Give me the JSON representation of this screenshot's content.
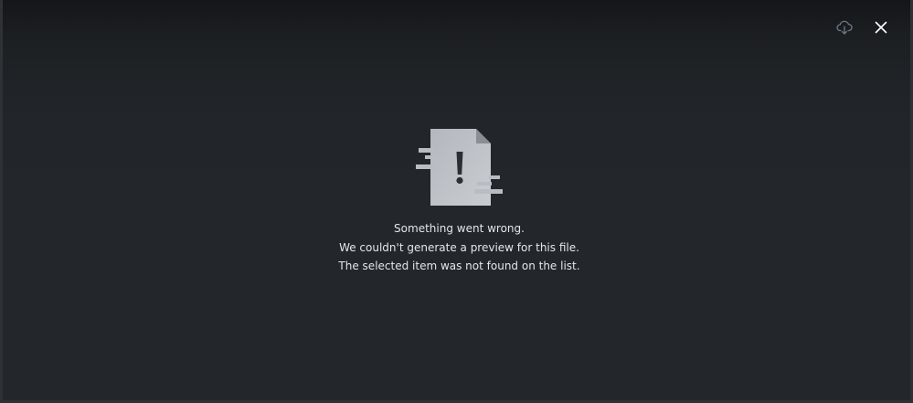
{
  "toolbar": {
    "download_icon": "cloud-download-icon",
    "close_icon": "close-icon"
  },
  "error": {
    "illustration_icon": "file-error-icon",
    "title": "Something went wrong.",
    "line1": "We couldn't generate a preview for this file.",
    "line2": "The selected item was not found on the list."
  },
  "colors": {
    "background": "#23272b",
    "text": "#e4e6e8",
    "icon_muted": "#6c7a87",
    "icon_light": "#ffffff",
    "illustration": "#b9bcc2"
  }
}
